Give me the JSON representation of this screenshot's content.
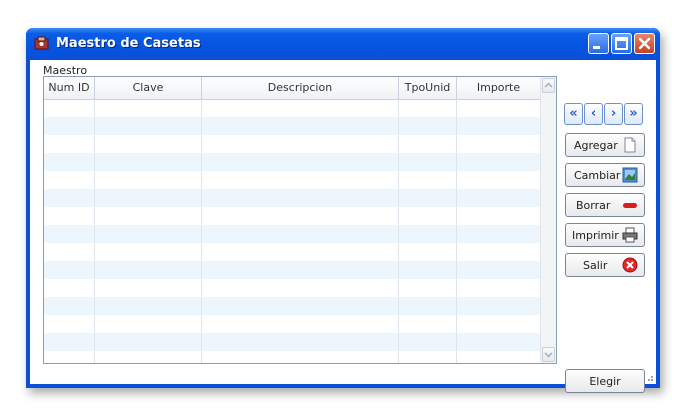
{
  "window": {
    "title": "Maestro de Casetas"
  },
  "grid": {
    "label": "Maestro",
    "columns": [
      "Num ID",
      "Clave",
      "Descripcion",
      "TpoUnid",
      "Importe"
    ],
    "row_count": 15
  },
  "nav": {
    "first": "«",
    "prev": "‹",
    "next": "›",
    "last": "»"
  },
  "buttons": {
    "agregar": "Agregar",
    "cambiar": "Cambiar",
    "borrar": "Borrar",
    "imprimir": "Imprimir",
    "salir": "Salir",
    "elegir": "Elegir"
  },
  "colors": {
    "titlebar": "#0a4fd6",
    "alt_row": "#eef6fd",
    "delete": "#d81e1e",
    "exit": "#e02a2a"
  }
}
